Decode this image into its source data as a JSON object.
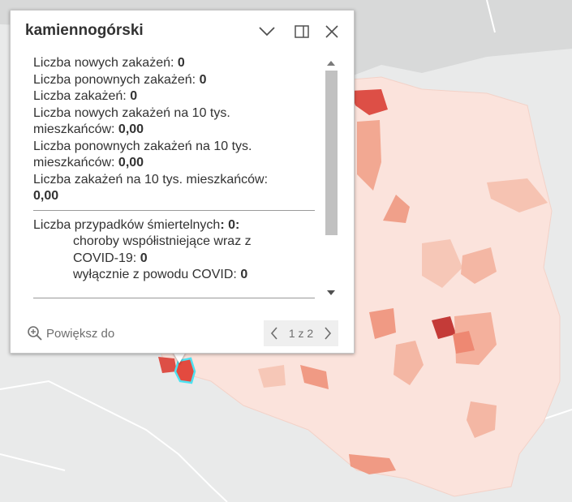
{
  "popup": {
    "title": "kamiennogórski",
    "close_icon": "close-icon",
    "dock_icon": "dock-icon",
    "collapse_icon": "chevron-down-icon",
    "fields": {
      "new_cases_label": "Liczba nowych zakażeń: ",
      "new_cases_value": "0",
      "reinfections_label": "Liczba ponownych zakażeń: ",
      "reinfections_value": "0",
      "total_cases_label": "Liczba zakażeń: ",
      "total_cases_value": "0",
      "new_per10k_label_1": "Liczba nowych zakażeń na 10 tys.",
      "new_per10k_label_2": "mieszkańców: ",
      "new_per10k_value": "0,00",
      "reinf_per10k_label_1": "Liczba ponownych zakażeń na 10 tys.",
      "reinf_per10k_label_2": "mieszkańców: ",
      "reinf_per10k_value": "0,00",
      "cases_per10k_label": "Liczba zakażeń na 10 tys. mieszkańców:",
      "cases_per10k_value": "0,00",
      "deaths_label": "Liczba przypadków śmiertelnych",
      "deaths_value": ": 0:",
      "comorb_label_1": "choroby współistniejące wraz z",
      "comorb_label_2": "COVID-19: ",
      "comorb_value": "0",
      "covid_only_label": "wyłącznie z powodu COVID: ",
      "covid_only_value": "0"
    },
    "zoom_label": "Powiększ do",
    "pager_text": "1 z 2"
  },
  "colors": {
    "background": "#e9eaea",
    "poland_base": "#fbe3dc",
    "choropleth_low": "#f6c7b7",
    "choropleth_mid": "#f09a84",
    "choropleth_high": "#dd4f46",
    "selected_outline": "#4ee1f0"
  }
}
